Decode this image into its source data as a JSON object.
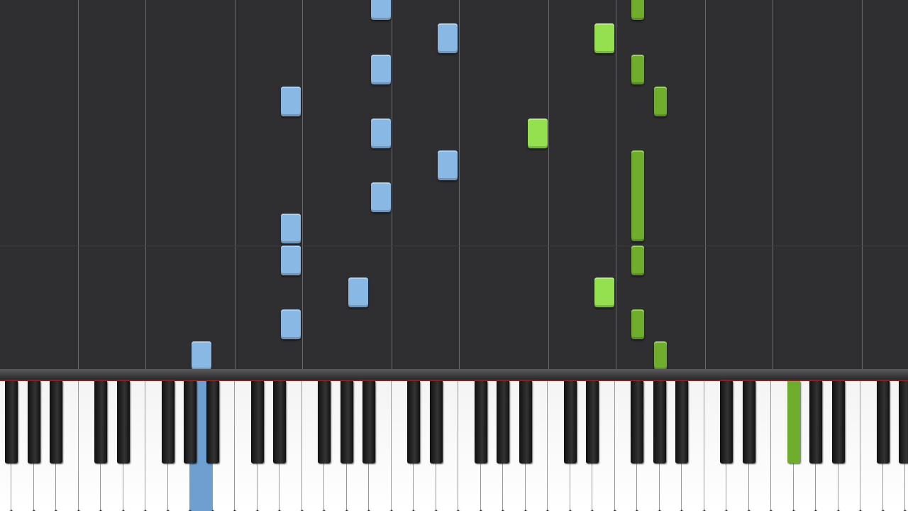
{
  "notes": [
    {
      "color": "#8ab8e4"
    },
    {
      "color": "#8ab8e4"
    },
    {
      "color": "#8ab8e4"
    },
    {
      "color": "#8ab8e4"
    },
    {
      "color": "#8ab8e4"
    },
    {
      "color": "#8ab8e4"
    },
    {
      "color": "#8ab8e4"
    },
    {
      "color": "#8ab8e4"
    },
    {
      "color": "#8ab8e4"
    },
    {
      "color": "#8ab8e4"
    },
    {
      "color": "#8ab8e4"
    },
    {
      "color": "#8ab8e4"
    },
    {
      "color": "#94e04e"
    },
    {
      "color": "#94e04e"
    },
    {
      "color": "#94e04e"
    },
    {
      "color": "#6fae2c"
    },
    {
      "color": "#6fae2c"
    },
    {
      "color": "#6fae2c"
    },
    {
      "color": "#6fae2c"
    },
    {
      "color": "#6fae2c"
    },
    {
      "color": "#6fae2c"
    },
    {
      "color": "#6fae2c"
    }
  ],
  "keyboard": {
    "white_keys": [
      {
        "pressed": false
      },
      {
        "pressed": false
      },
      {
        "pressed": false
      },
      {
        "pressed": false
      },
      {
        "pressed": false
      },
      {
        "pressed": false
      },
      {
        "pressed": false
      },
      {
        "pressed": false
      },
      {
        "pressed": false
      },
      {
        "pressed": true,
        "color": "#6e9fd0"
      },
      {
        "pressed": false
      },
      {
        "pressed": false
      },
      {
        "pressed": false
      },
      {
        "pressed": false
      },
      {
        "pressed": false
      },
      {
        "pressed": false
      },
      {
        "pressed": false
      },
      {
        "pressed": false
      },
      {
        "pressed": false
      },
      {
        "pressed": false
      },
      {
        "pressed": false
      },
      {
        "pressed": false
      },
      {
        "pressed": false
      },
      {
        "pressed": false
      },
      {
        "pressed": false
      },
      {
        "pressed": false
      },
      {
        "pressed": false
      },
      {
        "pressed": false
      },
      {
        "pressed": false
      },
      {
        "pressed": false
      },
      {
        "pressed": false
      },
      {
        "pressed": false
      },
      {
        "pressed": false
      },
      {
        "pressed": false
      },
      {
        "pressed": false
      },
      {
        "pressed": false
      },
      {
        "pressed": false
      },
      {
        "pressed": false
      },
      {
        "pressed": false
      },
      {
        "pressed": false
      },
      {
        "pressed": false
      },
      {
        "pressed": false
      }
    ],
    "black_keys": [
      {
        "pressed": false
      },
      {
        "pressed": false
      },
      {
        "pressed": false
      },
      {
        "pressed": false
      },
      {
        "pressed": false
      },
      {
        "pressed": false
      },
      {
        "pressed": false
      },
      {
        "pressed": false
      },
      {
        "pressed": false
      },
      {
        "pressed": false
      },
      {
        "pressed": false
      },
      {
        "pressed": false
      },
      {
        "pressed": false
      },
      {
        "pressed": false
      },
      {
        "pressed": false
      },
      {
        "pressed": false
      },
      {
        "pressed": false
      },
      {
        "pressed": false
      },
      {
        "pressed": false
      },
      {
        "pressed": false
      },
      {
        "pressed": false
      },
      {
        "pressed": false
      },
      {
        "pressed": false
      },
      {
        "pressed": false
      },
      {
        "pressed": false
      },
      {
        "pressed": true,
        "color": "#6fae2c"
      },
      {
        "pressed": false
      },
      {
        "pressed": false
      },
      {
        "pressed": false
      },
      {
        "pressed": false
      }
    ]
  }
}
